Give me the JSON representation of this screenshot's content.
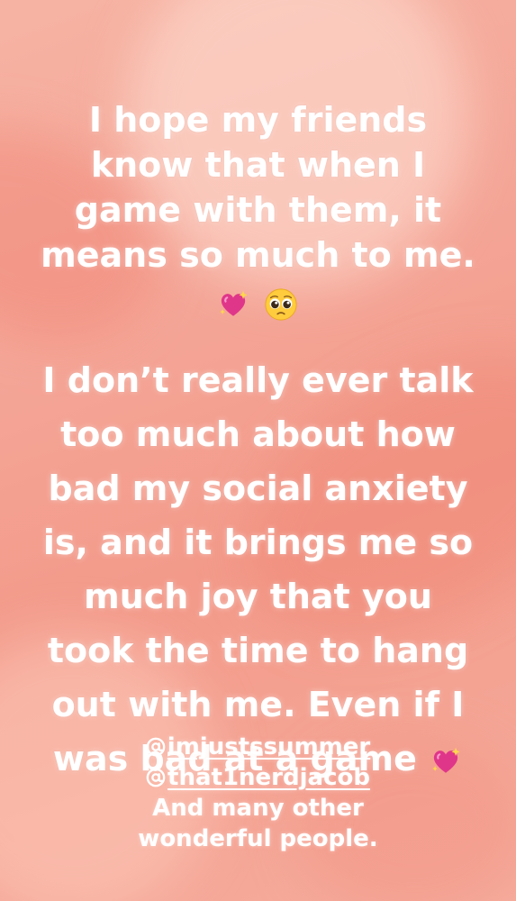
{
  "story": {
    "paragraph1": {
      "lines": [
        "I hope my friends",
        "know that when I",
        "game with them, it",
        "means so much to me."
      ],
      "emojis": [
        "sparkling-heart",
        "pleading-face"
      ]
    },
    "paragraph2": {
      "lines": [
        "I don’t really ever talk",
        "too much about how",
        "bad my social anxiety",
        "is, and it brings me so",
        "much joy that you",
        "took the time to hang",
        "out with me. Even if I",
        "was bad at a game"
      ],
      "trailing_emoji": "sparkling-heart"
    },
    "mentions": [
      "imjustssummer",
      "that1nerdjacob"
    ],
    "closing_lines": [
      "And many other",
      "wonderful people."
    ]
  },
  "colors": {
    "background": "#f4a596",
    "text": "#ffffff",
    "heart": "#e0368a"
  }
}
